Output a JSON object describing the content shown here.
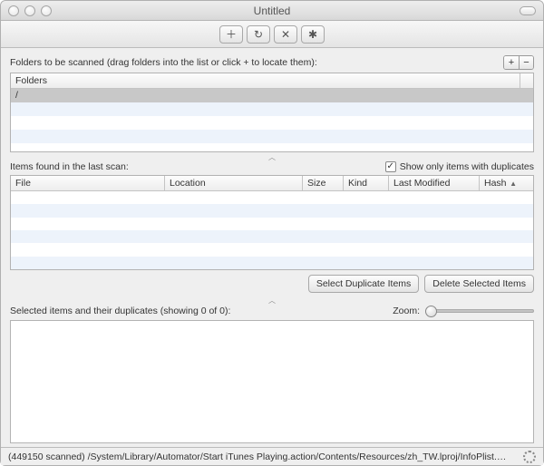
{
  "window": {
    "title": "Untitled"
  },
  "toolbar": {
    "add_icon": "＋",
    "refresh_icon": "↻",
    "stop_icon": "✕",
    "settings_icon": "✱"
  },
  "folders": {
    "label": "Folders to be scanned (drag folders into the list or click + to locate them):",
    "plus": "+",
    "minus": "−",
    "header": "Folders",
    "rows": [
      "/"
    ]
  },
  "items": {
    "label": "Items found in the last scan:",
    "show_only_label": "Show only items with duplicates",
    "checked": "✓",
    "headers": {
      "file": "File",
      "location": "Location",
      "size": "Size",
      "kind": "Kind",
      "last_modified": "Last Modified",
      "hash": "Hash"
    }
  },
  "actions": {
    "select_dup": "Select Duplicate Items",
    "delete_sel": "Delete Selected Items"
  },
  "selected": {
    "label": "Selected items and their duplicates (showing 0 of 0):",
    "zoom_label": "Zoom:"
  },
  "status": {
    "text": "(449150 scanned) /System/Library/Automator/Start iTunes Playing.action/Contents/Resources/zh_TW.lproj/InfoPlist.strings"
  }
}
